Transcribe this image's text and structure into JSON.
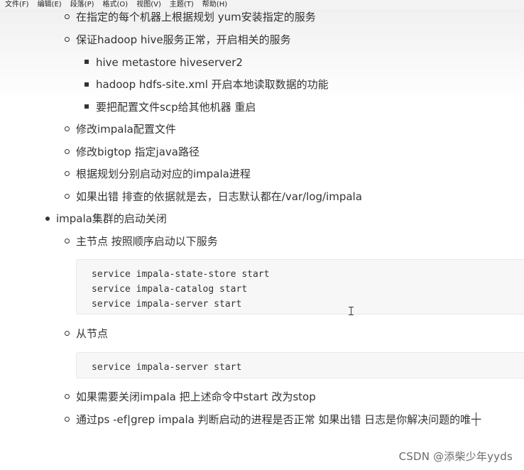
{
  "menubar": {
    "items": [
      "文件(F)",
      "编辑(E)",
      "段落(P)",
      "格式(O)",
      "视图(V)",
      "主题(T)",
      "帮助(H)"
    ]
  },
  "content": {
    "lines": [
      "在指定的每个机器上根据规划 yum安装指定的服务",
      "保证hadoop hive服务正常，开启相关的服务",
      "hive   metastore  hiveserver2",
      "hadoop hdfs-site.xml  开启本地读取数据的功能",
      "要把配置文件scp给其他机器 重启",
      "修改impala配置文件",
      "修改bigtop  指定java路径",
      "根据规划分别启动对应的impala进程",
      "如果出错  排查的依据就是去，日志默认都在/var/log/impala",
      "impala集群的启动关闭",
      "主节点  按照顺序启动以下服务",
      "从节点",
      "如果需要关闭impala  把上述命令中start 改为stop",
      "通过ps -ef|grep impala 判断启动的进程是否正常 如果出错 日志是你解决问题的唯一"
    ],
    "code_master": [
      "service impala-state-store start",
      "service impala-catalog start",
      "service impala-server start"
    ],
    "code_slave": [
      "service impala-server start"
    ]
  },
  "watermark": "CSDN @添柴少年yyds"
}
